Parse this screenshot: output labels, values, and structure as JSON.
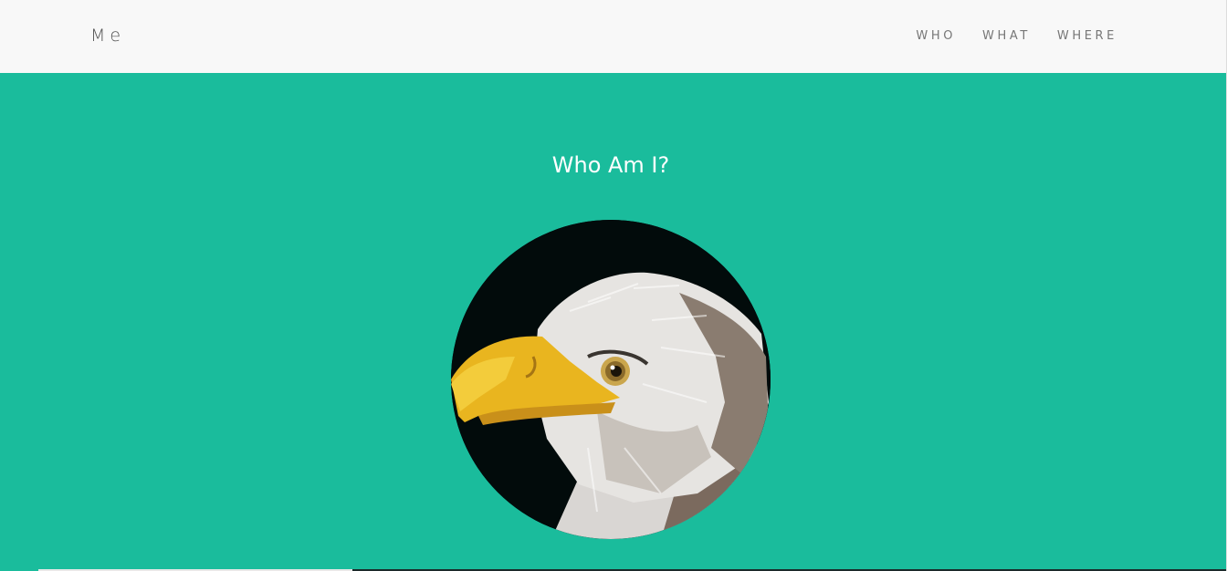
{
  "navbar": {
    "brand": "Me",
    "links": [
      {
        "label": "WHO"
      },
      {
        "label": "WHAT"
      },
      {
        "label": "WHERE"
      }
    ]
  },
  "hero": {
    "title": "Who Am I?",
    "avatar_icon": "eagle-portrait",
    "background_color": "#1abc9c",
    "title_color": "#ffffff"
  }
}
